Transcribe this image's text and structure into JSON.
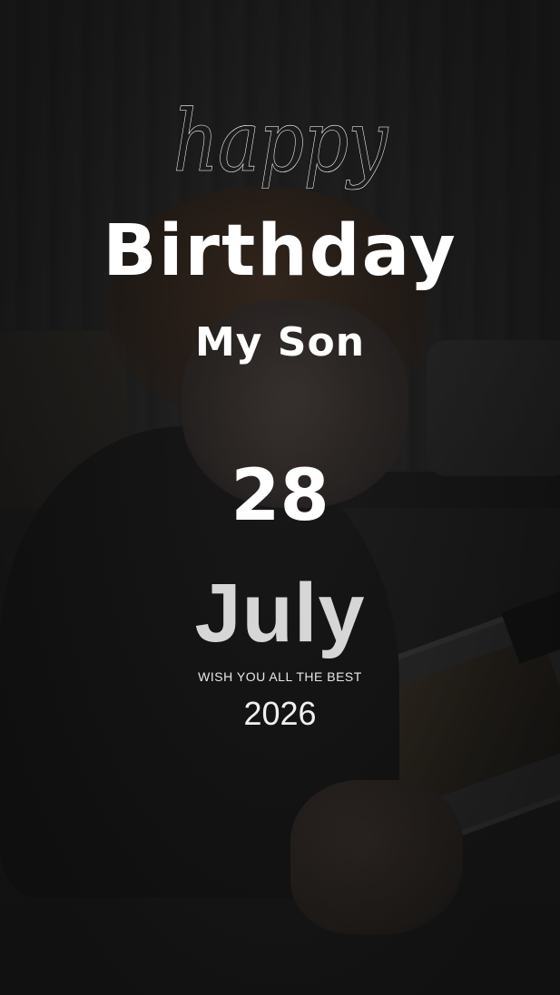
{
  "greeting": {
    "script_word": "happy",
    "headline": "Birthday",
    "recipient": "My Son"
  },
  "date": {
    "day": "28",
    "month": "July",
    "wish": "WISH YOU ALL THE BEST",
    "year": "2026"
  },
  "colors": {
    "text_primary": "#ffffff",
    "text_month": "#d6d6d6",
    "background": "#171717"
  }
}
